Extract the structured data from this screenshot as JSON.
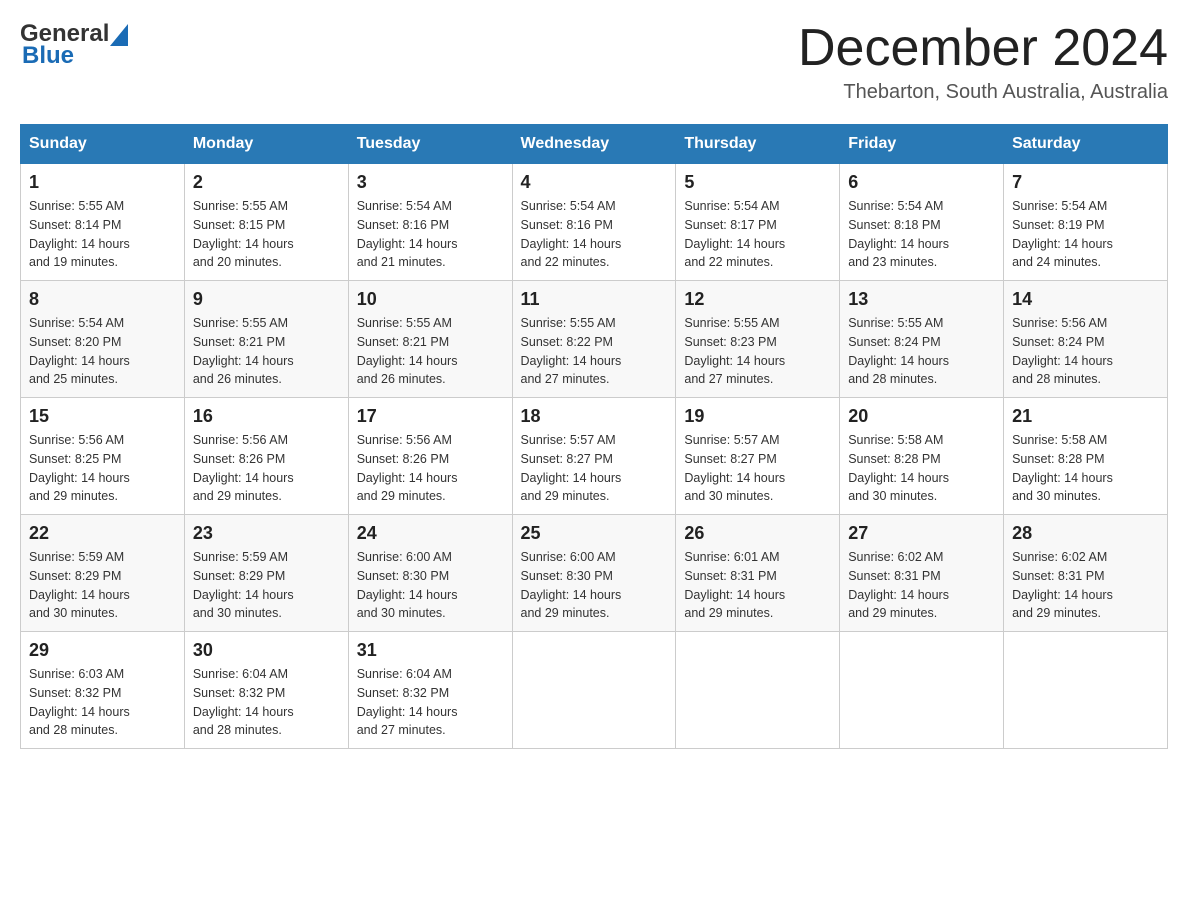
{
  "header": {
    "logo_general": "General",
    "logo_blue": "Blue",
    "month_title": "December 2024",
    "location": "Thebarton, South Australia, Australia"
  },
  "calendar": {
    "days_of_week": [
      "Sunday",
      "Monday",
      "Tuesday",
      "Wednesday",
      "Thursday",
      "Friday",
      "Saturday"
    ],
    "weeks": [
      [
        {
          "day": "1",
          "sunrise": "5:55 AM",
          "sunset": "8:14 PM",
          "daylight": "14 hours and 19 minutes."
        },
        {
          "day": "2",
          "sunrise": "5:55 AM",
          "sunset": "8:15 PM",
          "daylight": "14 hours and 20 minutes."
        },
        {
          "day": "3",
          "sunrise": "5:54 AM",
          "sunset": "8:16 PM",
          "daylight": "14 hours and 21 minutes."
        },
        {
          "day": "4",
          "sunrise": "5:54 AM",
          "sunset": "8:16 PM",
          "daylight": "14 hours and 22 minutes."
        },
        {
          "day": "5",
          "sunrise": "5:54 AM",
          "sunset": "8:17 PM",
          "daylight": "14 hours and 22 minutes."
        },
        {
          "day": "6",
          "sunrise": "5:54 AM",
          "sunset": "8:18 PM",
          "daylight": "14 hours and 23 minutes."
        },
        {
          "day": "7",
          "sunrise": "5:54 AM",
          "sunset": "8:19 PM",
          "daylight": "14 hours and 24 minutes."
        }
      ],
      [
        {
          "day": "8",
          "sunrise": "5:54 AM",
          "sunset": "8:20 PM",
          "daylight": "14 hours and 25 minutes."
        },
        {
          "day": "9",
          "sunrise": "5:55 AM",
          "sunset": "8:21 PM",
          "daylight": "14 hours and 26 minutes."
        },
        {
          "day": "10",
          "sunrise": "5:55 AM",
          "sunset": "8:21 PM",
          "daylight": "14 hours and 26 minutes."
        },
        {
          "day": "11",
          "sunrise": "5:55 AM",
          "sunset": "8:22 PM",
          "daylight": "14 hours and 27 minutes."
        },
        {
          "day": "12",
          "sunrise": "5:55 AM",
          "sunset": "8:23 PM",
          "daylight": "14 hours and 27 minutes."
        },
        {
          "day": "13",
          "sunrise": "5:55 AM",
          "sunset": "8:24 PM",
          "daylight": "14 hours and 28 minutes."
        },
        {
          "day": "14",
          "sunrise": "5:56 AM",
          "sunset": "8:24 PM",
          "daylight": "14 hours and 28 minutes."
        }
      ],
      [
        {
          "day": "15",
          "sunrise": "5:56 AM",
          "sunset": "8:25 PM",
          "daylight": "14 hours and 29 minutes."
        },
        {
          "day": "16",
          "sunrise": "5:56 AM",
          "sunset": "8:26 PM",
          "daylight": "14 hours and 29 minutes."
        },
        {
          "day": "17",
          "sunrise": "5:56 AM",
          "sunset": "8:26 PM",
          "daylight": "14 hours and 29 minutes."
        },
        {
          "day": "18",
          "sunrise": "5:57 AM",
          "sunset": "8:27 PM",
          "daylight": "14 hours and 29 minutes."
        },
        {
          "day": "19",
          "sunrise": "5:57 AM",
          "sunset": "8:27 PM",
          "daylight": "14 hours and 30 minutes."
        },
        {
          "day": "20",
          "sunrise": "5:58 AM",
          "sunset": "8:28 PM",
          "daylight": "14 hours and 30 minutes."
        },
        {
          "day": "21",
          "sunrise": "5:58 AM",
          "sunset": "8:28 PM",
          "daylight": "14 hours and 30 minutes."
        }
      ],
      [
        {
          "day": "22",
          "sunrise": "5:59 AM",
          "sunset": "8:29 PM",
          "daylight": "14 hours and 30 minutes."
        },
        {
          "day": "23",
          "sunrise": "5:59 AM",
          "sunset": "8:29 PM",
          "daylight": "14 hours and 30 minutes."
        },
        {
          "day": "24",
          "sunrise": "6:00 AM",
          "sunset": "8:30 PM",
          "daylight": "14 hours and 30 minutes."
        },
        {
          "day": "25",
          "sunrise": "6:00 AM",
          "sunset": "8:30 PM",
          "daylight": "14 hours and 29 minutes."
        },
        {
          "day": "26",
          "sunrise": "6:01 AM",
          "sunset": "8:31 PM",
          "daylight": "14 hours and 29 minutes."
        },
        {
          "day": "27",
          "sunrise": "6:02 AM",
          "sunset": "8:31 PM",
          "daylight": "14 hours and 29 minutes."
        },
        {
          "day": "28",
          "sunrise": "6:02 AM",
          "sunset": "8:31 PM",
          "daylight": "14 hours and 29 minutes."
        }
      ],
      [
        {
          "day": "29",
          "sunrise": "6:03 AM",
          "sunset": "8:32 PM",
          "daylight": "14 hours and 28 minutes."
        },
        {
          "day": "30",
          "sunrise": "6:04 AM",
          "sunset": "8:32 PM",
          "daylight": "14 hours and 28 minutes."
        },
        {
          "day": "31",
          "sunrise": "6:04 AM",
          "sunset": "8:32 PM",
          "daylight": "14 hours and 27 minutes."
        },
        null,
        null,
        null,
        null
      ]
    ],
    "labels": {
      "sunrise": "Sunrise: ",
      "sunset": "Sunset: ",
      "daylight": "Daylight: "
    }
  }
}
